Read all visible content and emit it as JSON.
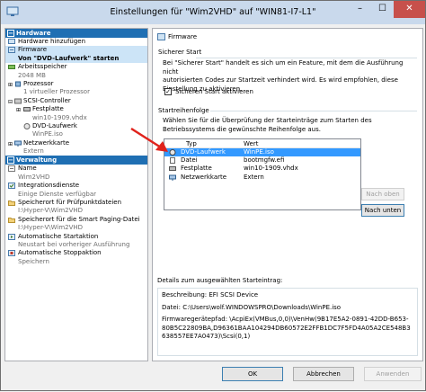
{
  "window": {
    "title": "Einstellungen für \"Wim2VHD\" auf \"WIN81-I7-L1\"",
    "min_glyph": "–",
    "max_glyph": "☐",
    "close_glyph": "✕"
  },
  "sidebar": {
    "hardware_header": "Hardware",
    "items": [
      {
        "label": "Hardware hinzufügen"
      },
      {
        "label": "Firmware",
        "sub": "Von \"DVD-Laufwerk\" starten"
      },
      {
        "label": "Arbeitsspeicher",
        "sub": "2048 MB"
      },
      {
        "label": "Prozessor",
        "sub": "1 virtueller Prozessor"
      },
      {
        "label": "SCSI-Controller"
      },
      {
        "label": "Festplatte",
        "sub": "win10-1909.vhdx"
      },
      {
        "label": "DVD-Laufwerk",
        "sub": "WinPE.iso"
      },
      {
        "label": "Netzwerkkarte",
        "sub": "Extern"
      }
    ],
    "management_header": "Verwaltung",
    "mgmt_items": [
      {
        "label": "Name",
        "sub": "Wim2VHD"
      },
      {
        "label": "Integrationsdienste",
        "sub": "Einige Dienste verfügbar"
      },
      {
        "label": "Speicherort für Prüfpunktdateien",
        "sub": "I:\\Hyper-V\\Wim2VHD"
      },
      {
        "label": "Speicherort für die Smart Paging-Datei",
        "sub": "I:\\Hyper-V\\Wim2VHD"
      },
      {
        "label": "Automatische Startaktion",
        "sub": "Neustart bei vorheriger Ausführung"
      },
      {
        "label": "Automatische Stoppaktion",
        "sub": "Speichern"
      }
    ]
  },
  "main": {
    "header": "Firmware",
    "secure_title": "Sicherer Start",
    "secure_text": [
      "Bei \"Sicherer Start\" handelt es sich um ein Feature, mit dem die Ausführung nicht",
      "autorisierten Codes zur Startzeit verhindert wird. Es wird empfohlen, diese",
      "Einstellung zu aktivieren."
    ],
    "secure_checkbox": "Sicheren Start aktivieren",
    "boot_title": "Startreihenfolge",
    "boot_text": [
      "Wählen Sie für die Überprüfung der Starteinträge zum Starten des",
      "Betriebssystems die gewünschte Reihenfolge aus."
    ],
    "col_type": "Typ",
    "col_value": "Wert",
    "boot_entries": [
      {
        "type": "DVD-Laufwerk",
        "value": "WinPE.iso"
      },
      {
        "type": "Datei",
        "value": "bootmgfw.efi"
      },
      {
        "type": "Festplatte",
        "value": "win10-1909.vhdx"
      },
      {
        "type": "Netzwerkkarte",
        "value": "Extern"
      }
    ],
    "move_up": "Nach oben",
    "move_down": "Nach unten",
    "details_title": "Details zum ausgewählten Starteintrag:",
    "details_lines": [
      "Beschreibung: EFI SCSI Device",
      "",
      "Datei: C:\\Users\\wolf.WINDOWSPRO\\Downloads\\WinPE.iso",
      "",
      "Firmwaregerätepfad: \\AcpiEx(VMBus,0,0)\\VenHw(9B17E5A2-0891-42DD-B653-",
      "80B5C22809BA,D96361BAA104294DB60572E2FFB1DC7F5FD4A05A2CE548B3",
      "638557EE7A0473)\\Scsi(0,1)"
    ]
  },
  "footer": {
    "ok": "OK",
    "cancel": "Abbrechen",
    "apply": "Anwenden"
  },
  "colors": {
    "section_header": "#1f6fb3",
    "selection": "#3399ff",
    "arrow": "#e0231c"
  }
}
